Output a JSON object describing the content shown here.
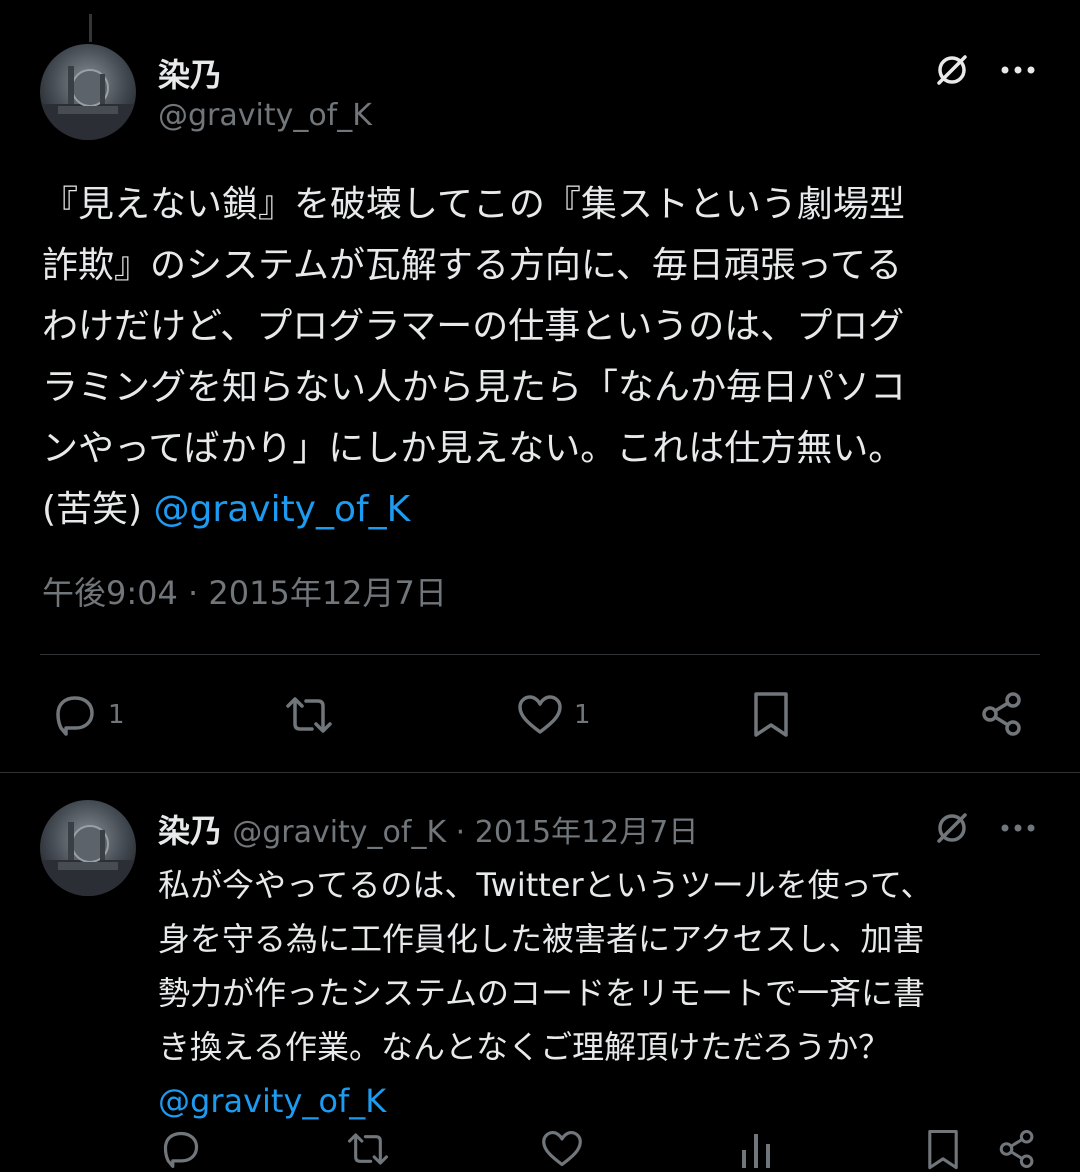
{
  "main_tweet": {
    "display_name": "染乃",
    "handle": "@gravity_of_K",
    "text_lines": [
      "『見えない鎖』を破壊してこの『集ストという劇場型",
      "詐欺』のシステムが瓦解する方向に、毎日頑張ってる",
      "わけだけど、プログラマーの仕事というのは、プログ",
      "ラミングを知らない人から見たら「なんか毎日パソコ",
      "ンやってばかり」にしか見えない。これは仕方無い。"
    ],
    "last_line_prefix": "(苦笑) ",
    "mention": "@gravity_of_K",
    "timestamp": "午後9:04 · 2015年12月7日",
    "reply_count": "1",
    "like_count": "1"
  },
  "reply_tweet": {
    "display_name": "染乃",
    "meta": "@gravity_of_K · 2015年12月7日",
    "text_lines": [
      "私が今やってるのは、Twitterというツールを使って、",
      "身を守る為に工作員化した被害者にアクセスし、加害",
      "勢力が作ったシステムのコードをリモートで一斉に書",
      "き換える作業。なんとなくご理解頂けただろうか？"
    ],
    "mention": "@gravity_of_K"
  },
  "colors": {
    "background": "#000000",
    "text": "#e7e9ea",
    "muted": "#71767b",
    "link": "#1d9bf0",
    "divider": "#2f3336"
  },
  "icons": [
    "grok-icon",
    "more-icon",
    "reply-icon",
    "retweet-icon",
    "like-icon",
    "bookmark-icon",
    "share-icon",
    "views-icon"
  ]
}
